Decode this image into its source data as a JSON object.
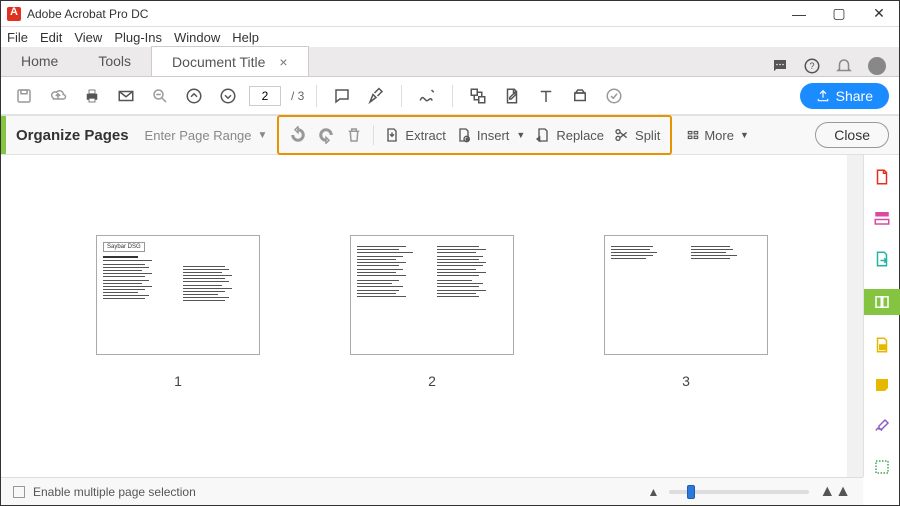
{
  "window": {
    "title": "Adobe Acrobat Pro DC"
  },
  "menu": {
    "file": "File",
    "edit": "Edit",
    "view": "View",
    "plugins": "Plug-Ins",
    "window": "Window",
    "help": "Help"
  },
  "tabs": {
    "home": "Home",
    "tools": "Tools",
    "document": "Document Title"
  },
  "toolbar": {
    "page_current": "2",
    "page_total": "/  3",
    "share": "Share"
  },
  "organize": {
    "title": "Organize Pages",
    "page_range_placeholder": "Enter Page Range",
    "extract": "Extract",
    "insert": "Insert",
    "replace": "Replace",
    "split": "Split",
    "more": "More",
    "close": "Close"
  },
  "pages": {
    "p1": "1",
    "p2": "2",
    "p3": "3",
    "thumb_tag": "Saybar  DSG"
  },
  "footer": {
    "enable_multi": "Enable multiple page selection"
  }
}
